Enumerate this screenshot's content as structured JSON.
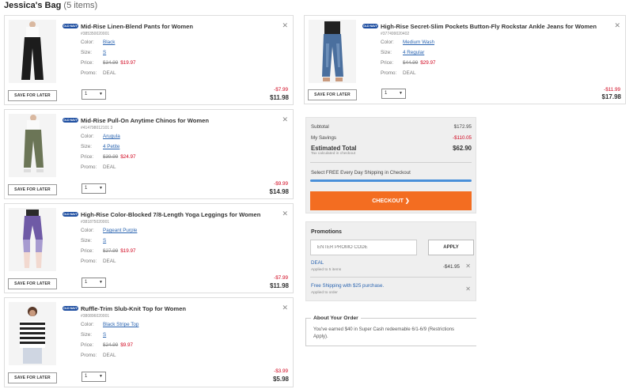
{
  "bag": {
    "title": "Jessica's Bag",
    "count": "(5 items)"
  },
  "labels": {
    "color": "Color:",
    "size": "Size:",
    "price": "Price:",
    "promo": "Promo:",
    "save_for_later": "SAVE FOR LATER",
    "brand": "OLD NAVY"
  },
  "items": [
    {
      "title": "Mid-Rise Linen-Blend Pants for Women",
      "sku": "#385350020001",
      "color": "Black",
      "size": "S",
      "was": "$34.99",
      "now": "$19.97",
      "promo": "DEAL",
      "qty": "1",
      "discount": "-$7.99",
      "total": "$11.98"
    },
    {
      "title": "Mid-Rise Pull-On Anytime Chinos for Women",
      "sku": "#414798012101 3",
      "color": "Arugula",
      "size": "4 Petite",
      "was": "$39.99",
      "now": "$24.97",
      "promo": "DEAL",
      "qty": "1",
      "discount": "-$9.99",
      "total": "$14.98"
    },
    {
      "title": "High-Rise Color-Blocked 7/8-Length Yoga Leggings for Women",
      "sku": "#381875020001",
      "color": "Pageant Purple",
      "size": "S",
      "was": "$27.99",
      "now": "$19.97",
      "promo": "DEAL",
      "qty": "1",
      "discount": "-$7.99",
      "total": "$11.98"
    },
    {
      "title": "Ruffle-Trim Slub-Knit Top for Women",
      "sku": "#380896020001",
      "color": "Black Stripe Top",
      "size": "S",
      "was": "$24.99",
      "now": "$9.97",
      "promo": "DEAL",
      "qty": "1",
      "discount": "-$3.99",
      "total": "$5.98"
    },
    {
      "title": "High-Rise Secret-Slim Pockets Button-Fly Rockstar Ankle Jeans for Women",
      "sku": "#377499020402",
      "color": "Medium Wash",
      "size": "4 Regular",
      "was": "$44.99",
      "now": "$29.97",
      "promo": "DEAL",
      "qty": "1",
      "discount": "-$11.99",
      "total": "$17.98"
    }
  ],
  "summary": {
    "subtotal_label": "Subtotal",
    "subtotal": "$172.95",
    "savings_label": "My Savings",
    "savings": "-$110.05",
    "estimated_label": "Estimated Total",
    "estimated": "$62.90",
    "tax_note": "Tax calculated in checkout",
    "shipping_text": "Select FREE Every Day Shipping in Checkout",
    "checkout_label": "CHECKOUT",
    "checkout_icon": "chevron-right-icon"
  },
  "promotions": {
    "heading": "Promotions",
    "input_placeholder": "ENTER PROMO CODE",
    "apply_label": "APPLY",
    "entries": [
      {
        "name": "DEAL",
        "sub": "Applied to 5 items",
        "amount": "-$41.95"
      },
      {
        "name": "Free Shipping with $25 purchase.",
        "sub": "Applied to order",
        "amount": ""
      }
    ]
  },
  "about": {
    "heading": "About Your Order",
    "text": "You've earned $40 in Super Cash redeemable 6/1-6/9 (Restrictions Apply)."
  },
  "colors": {
    "accent_orange": "#f36d21",
    "link_blue": "#2a64b0",
    "sale_red": "#d0021b",
    "brand_blue": "#1f4fa1"
  }
}
